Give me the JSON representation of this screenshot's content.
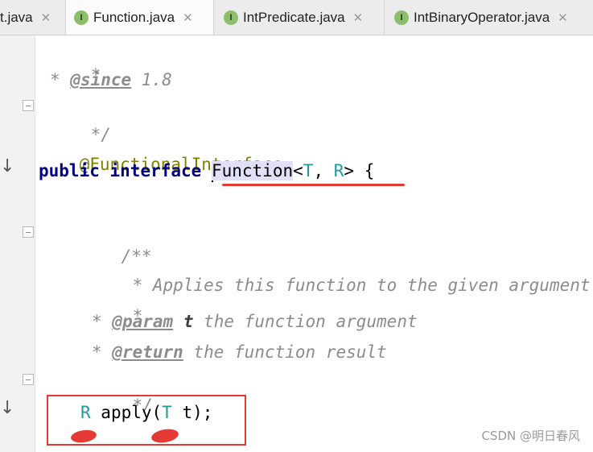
{
  "tabs": [
    {
      "label": "t.java",
      "icon": "",
      "active": false
    },
    {
      "label": "Function.java",
      "icon": "I",
      "active": true
    },
    {
      "label": "IntPredicate.java",
      "icon": "I",
      "active": false
    },
    {
      "label": "IntBinaryOperator.java",
      "icon": "I",
      "active": false
    }
  ],
  "tab_close_glyph": "✕",
  "code": {
    "l1": {
      "star": "*"
    },
    "l2": {
      "star": "* ",
      "tag": "@since",
      "rest": " 1.8"
    },
    "l3": {
      "text": "*/"
    },
    "l4": {
      "annotation": "@FunctionalInterface"
    },
    "l5": {
      "kw1": "public",
      "kw2": "interface",
      "name": "Function",
      "lt": "<",
      "t": "T",
      "comma": ", ",
      "r": "R",
      "gt": ">",
      "brace": " {"
    },
    "l6": {
      "text": "/**"
    },
    "l7": {
      "text": "* Applies this function to the given argument."
    },
    "l8": {
      "text": "*"
    },
    "l9": {
      "star": "* ",
      "tag": "@param",
      "pname": "t",
      "rest": " the function argument"
    },
    "l10": {
      "star": "* ",
      "tag": "@return",
      "rest": " the function result"
    },
    "l11": {
      "text": "*/"
    },
    "l12": {
      "ret": "R",
      "method": " apply(",
      "ptype": "T",
      "param": " t);"
    }
  },
  "watermark": "CSDN @明日春风",
  "colors": {
    "keyword": "#000080",
    "annotation": "#808000",
    "type_param": "#20999d",
    "comment": "#8c8c8c",
    "highlight": "#e53935"
  },
  "icons": {
    "interface_file": "interface-file-icon",
    "implemented_gutter": "implemented-arrow-icon",
    "fold": "fold-icon"
  }
}
